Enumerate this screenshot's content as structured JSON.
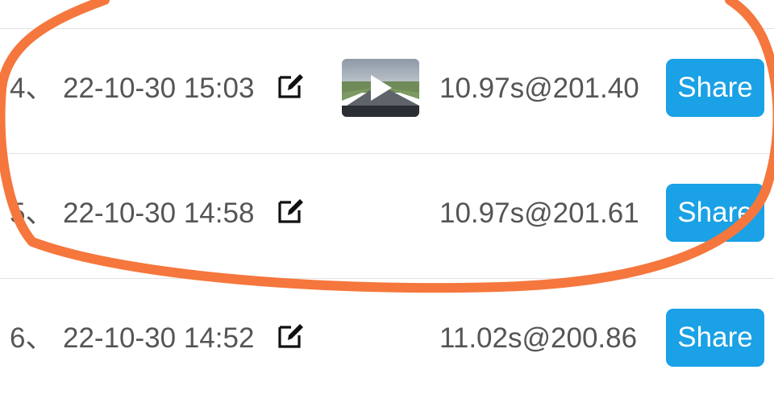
{
  "rows": [
    {
      "index": "4、",
      "timestamp": "22-10-30 15:03",
      "result": "10.97s@201.40",
      "share_label": "Share",
      "has_video": true
    },
    {
      "index": "5、",
      "timestamp": "22-10-30 14:58",
      "result": "10.97s@201.61",
      "share_label": "Share",
      "has_video": false
    },
    {
      "index": "6、",
      "timestamp": "22-10-30 14:52",
      "result": "11.02s@200.86",
      "share_label": "Share",
      "has_video": false
    }
  ],
  "icons": {
    "edit": "edit-icon",
    "play": "play-icon"
  },
  "colors": {
    "share_button": "#1aa1e6",
    "share_text": "#ffffff",
    "row_text": "#555555",
    "divider": "#e2e2e2",
    "annotation_stroke": "#f5773d"
  }
}
